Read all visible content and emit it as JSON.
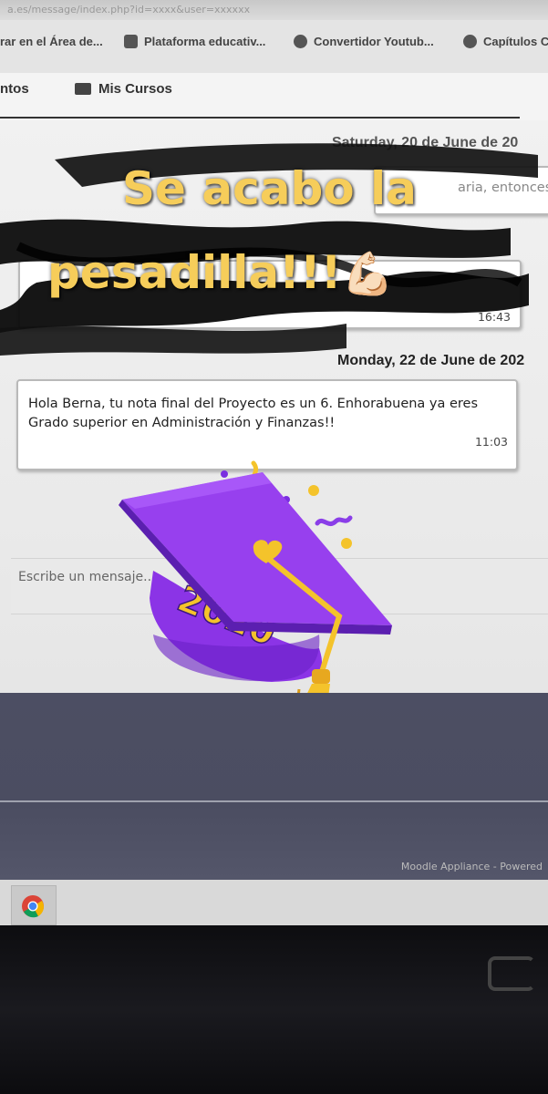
{
  "browser": {
    "url_text": "a.es/message/index.php?id=xxxx&user=xxxxxx",
    "bookmarks": [
      "rar en el Área de...",
      "Plataforma educativ...",
      "Convertidor Youtub...",
      "Capítulos C"
    ]
  },
  "nav": {
    "items": [
      "ntos",
      "Mis Cursos"
    ]
  },
  "chat": {
    "date_prev": "Saturday, 20 de June de 20",
    "prev_snippet": "aria, entonces",
    "prev_time": "16:43",
    "date_current": "Monday, 22 de June de 202",
    "message_text": "Hola Berna, tu nota final del Proyecto es un 6. Enhorabuena ya eres Grado superior en Administración y Finanzas!!",
    "message_time": "11:03",
    "compose_placeholder": "Escribe un mensaje..."
  },
  "overlay": {
    "headline_line1": "Se acabo la",
    "headline_line2": "pesadilla!!!",
    "emoji": "💪🏻",
    "sticker_year": "2020",
    "headline_color": "#f6cd5a",
    "cap_color": "#7a2ee0"
  },
  "footer": {
    "moodle_text": "Moodle Appliance - Powered"
  },
  "taskbar": {
    "pinned": [
      "chrome-icon"
    ]
  }
}
